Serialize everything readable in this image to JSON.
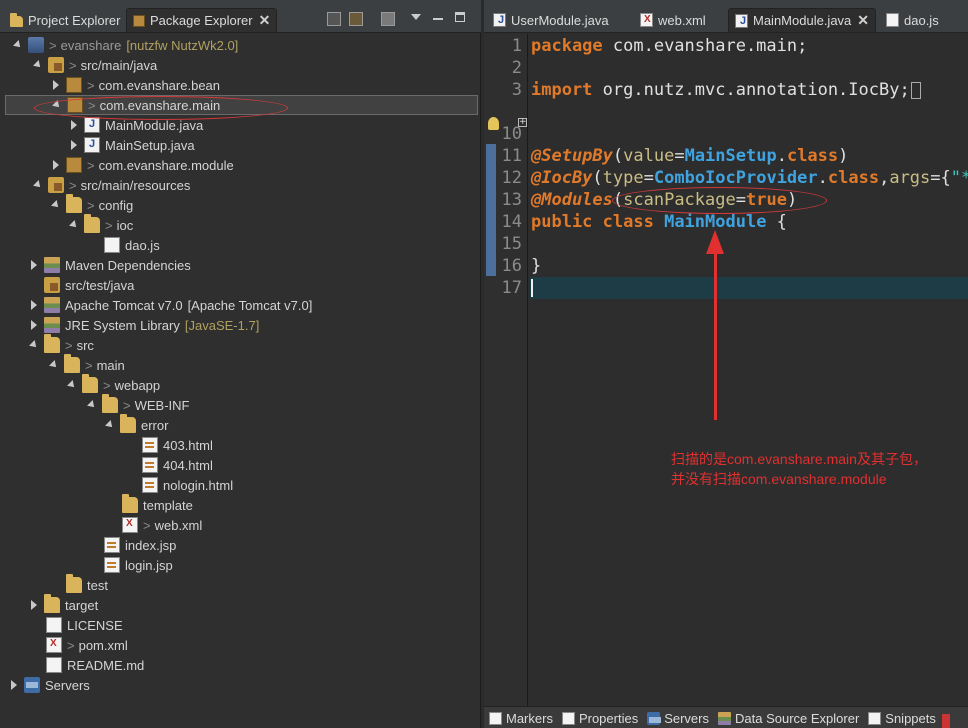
{
  "left_tabs": [
    {
      "label": "Project Explorer",
      "active": false
    },
    {
      "label": "Package Explorer",
      "active": true
    }
  ],
  "tree": [
    {
      "label": "evanshare",
      "suffix": "[nutzfw NutzWk2.0]",
      "dec": ">"
    },
    {
      "label": "src/main/java",
      "dec": ">"
    },
    {
      "label": "com.evanshare.bean",
      "dec": ">"
    },
    {
      "label": "com.evanshare.main",
      "dec": ">"
    },
    {
      "label": "MainModule.java"
    },
    {
      "label": "MainSetup.java"
    },
    {
      "label": "com.evanshare.module",
      "dec": ">"
    },
    {
      "label": "src/main/resources",
      "dec": ">"
    },
    {
      "label": "config",
      "dec": ">"
    },
    {
      "label": "ioc",
      "dec": ">"
    },
    {
      "label": "dao.js"
    },
    {
      "label": "Maven Dependencies"
    },
    {
      "label": "src/test/java"
    },
    {
      "label": "Apache Tomcat v7.0",
      "suffix": "[Apache Tomcat v7.0]"
    },
    {
      "label": "JRE System Library",
      "suffix": "[JavaSE-1.7]"
    },
    {
      "label": "src",
      "dec": ">"
    },
    {
      "label": "main",
      "dec": ">"
    },
    {
      "label": "webapp",
      "dec": ">"
    },
    {
      "label": "WEB-INF",
      "dec": ">"
    },
    {
      "label": "error"
    },
    {
      "label": "403.html"
    },
    {
      "label": "404.html"
    },
    {
      "label": "nologin.html"
    },
    {
      "label": "template"
    },
    {
      "label": "web.xml",
      "dec": ">"
    },
    {
      "label": "index.jsp"
    },
    {
      "label": "login.jsp"
    },
    {
      "label": "test"
    },
    {
      "label": "target"
    },
    {
      "label": "LICENSE"
    },
    {
      "label": "pom.xml",
      "dec": ">"
    },
    {
      "label": "README.md"
    },
    {
      "label": "Servers"
    }
  ],
  "editor_tabs": [
    {
      "label": "UserModule.java",
      "active": false
    },
    {
      "label": "web.xml",
      "active": false
    },
    {
      "label": "MainModule.java",
      "active": true
    },
    {
      "label": "dao.js",
      "active": false
    }
  ],
  "line_numbers": [
    "1",
    "2",
    "3",
    "10",
    "11",
    "12",
    "13",
    "14",
    "15",
    "16",
    "17"
  ],
  "code": {
    "l1_kw": "package",
    "l1_rest": " com.evanshare.main;",
    "l3_kw": "import",
    "l3_rest": " org.nutz.mvc.annotation.IocBy;",
    "l11_ann": "@SetupBy",
    "l11_p1": "(",
    "l11_param": "value",
    "l11_eq": "=",
    "l11_type": "MainSetup",
    "l11_dot": ".",
    "l11_kw": "class",
    "l11_end": ")",
    "l12_ann": "@IocBy",
    "l12_p1": "(",
    "l12_param": "type",
    "l12_eq": "=",
    "l12_type": "ComboIocProvider",
    "l12_dot": ".",
    "l12_kw": "class",
    "l12_comma": ",",
    "l12_param2": "args",
    "l12_eq2": "={",
    "l12_str": "\"*j",
    "l13_ann": "@Modules",
    "l13_p1": "(",
    "l13_param": "scanPackage",
    "l13_eq": "=",
    "l13_kw": "true",
    "l13_end": ")",
    "l14_kw1": "public",
    "l14_kw2": " class",
    "l14_type": " MainModule",
    "l14_end": " {",
    "l16": "}"
  },
  "annotation_note_line1": "扫描的是com.evanshare.main及其子包，",
  "annotation_note_line2": "并没有扫描com.evanshare.module",
  "bottom_tabs": [
    "Markers",
    "Properties",
    "Servers",
    "Data Source Explorer",
    "Snippets"
  ],
  "colors": {
    "annotation_red": "#e03030",
    "keyword": "#e07a2a",
    "type": "#3fa3e0"
  }
}
